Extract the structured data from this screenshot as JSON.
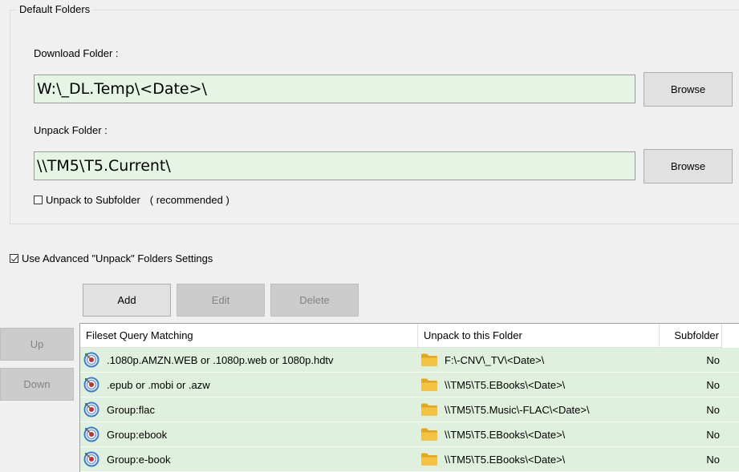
{
  "default_folders": {
    "title": "Default Folders",
    "download_label": "Download Folder :",
    "download_value": "W:\\_DL.Temp\\<Date>\\",
    "unpack_label": "Unpack Folder :",
    "unpack_value": "\\\\TM5\\T5.Current\\",
    "browse_label": "Browse",
    "unpack_subfolder_label": "Unpack to Subfolder",
    "unpack_subfolder_note": "( recommended )",
    "unpack_subfolder_checked": false
  },
  "advanced": {
    "label": "Use Advanced \"Unpack\" Folders Settings",
    "checked": true
  },
  "toolbar": {
    "add_label": "Add",
    "edit_label": "Edit",
    "delete_label": "Delete",
    "up_label": "Up",
    "down_label": "Down"
  },
  "grid": {
    "columns": [
      "Fileset Query Matching",
      "Unpack to this Folder",
      "Subfolder"
    ],
    "rows": [
      {
        "query": ".1080p.AMZN.WEB or .1080p.web or 1080p.hdtv",
        "folder": "F:\\-CNV\\_TV\\<Date>\\",
        "subfolder": "No"
      },
      {
        "query": ".epub or .mobi or .azw",
        "folder": "\\\\TM5\\T5.EBooks\\<Date>\\",
        "subfolder": "No"
      },
      {
        "query": "Group:flac",
        "folder": "\\\\TM5\\T5.Music\\-FLAC\\<Date>\\",
        "subfolder": "No"
      },
      {
        "query": "Group:ebook",
        "folder": "\\\\TM5\\T5.EBooks\\<Date>\\",
        "subfolder": "No"
      },
      {
        "query": "Group:e-book",
        "folder": "\\\\TM5\\T5.EBooks\\<Date>\\",
        "subfolder": "No"
      }
    ]
  },
  "icons": {
    "query_icon": "target-icon",
    "folder_icon": "folder-icon"
  },
  "colors": {
    "input_bg": "#e6f4e6",
    "row_bg": "#dff0df",
    "folder_yellow": "#f5c242",
    "target_red": "#d9252b",
    "target_blue": "#3a7bd5"
  }
}
